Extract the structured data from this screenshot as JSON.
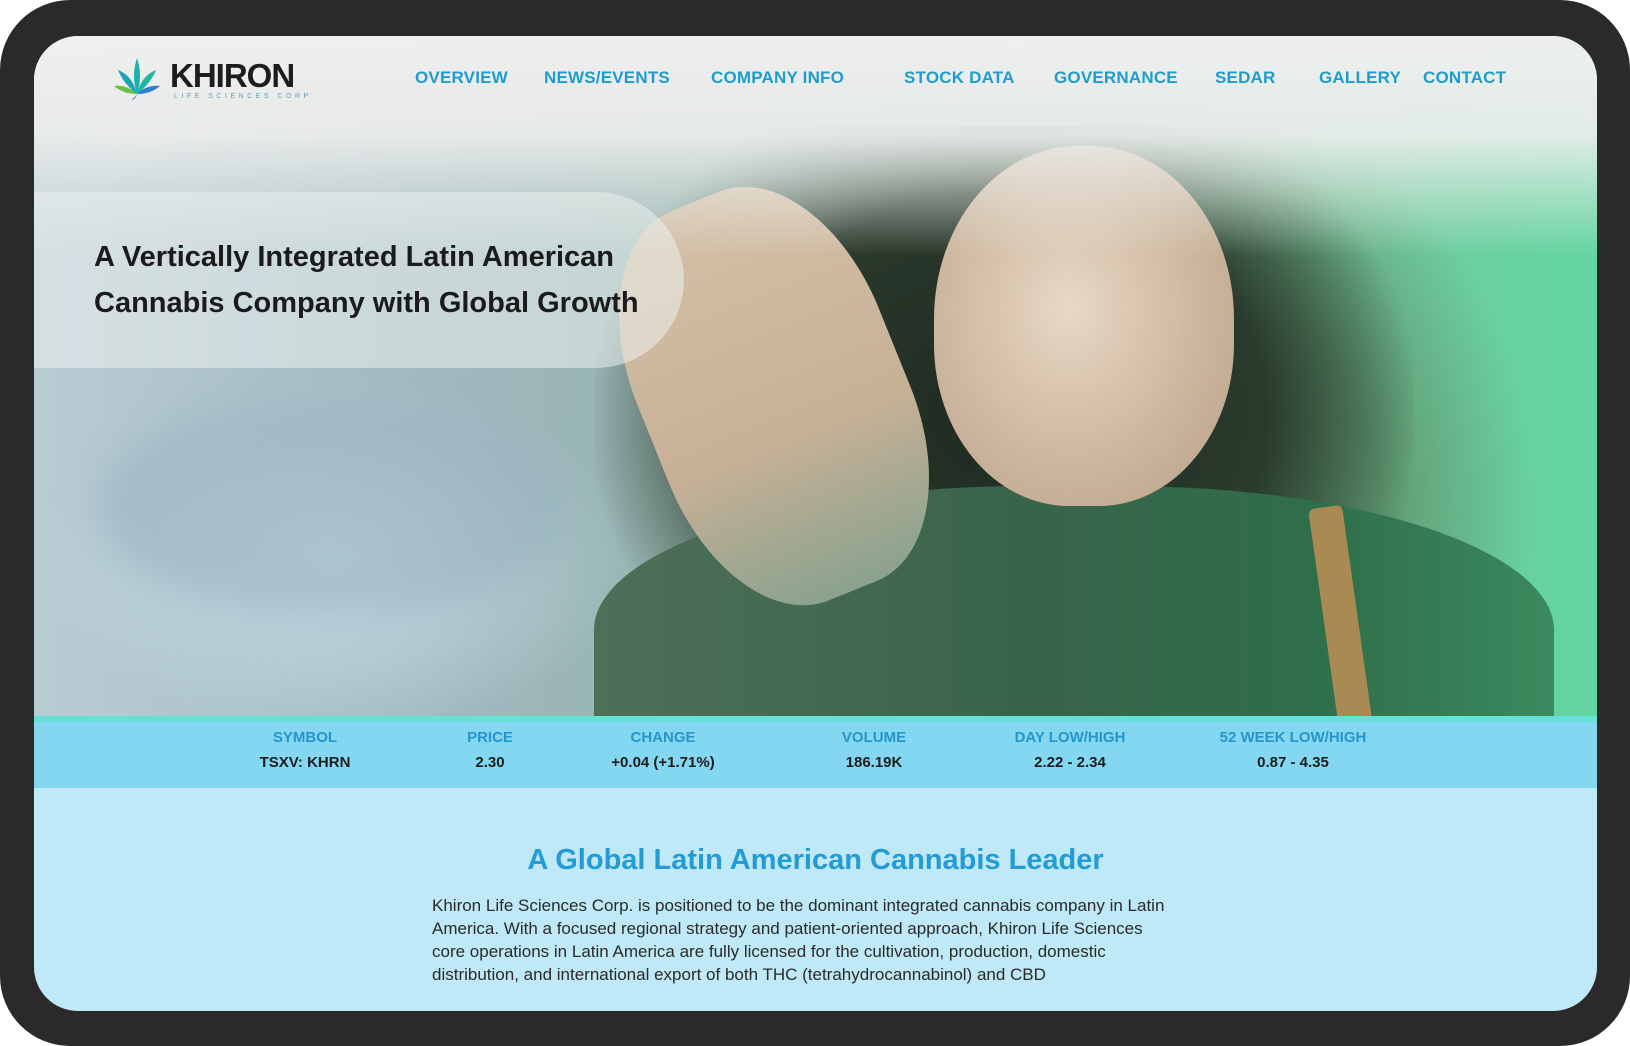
{
  "brand": {
    "name": "KHIRON",
    "tagline": "LIFE SCIENCES CORP",
    "colors": {
      "primary": "#1e9dcc",
      "leaf_teal": "#1bb3a8",
      "leaf_green": "#6cc04a",
      "leaf_blue": "#2f7fd0"
    }
  },
  "nav": {
    "items": [
      {
        "label": "OVERVIEW"
      },
      {
        "label": "NEWS/EVENTS"
      },
      {
        "label": "COMPANY INFO"
      },
      {
        "label": "STOCK DATA"
      },
      {
        "label": "GOVERNANCE"
      },
      {
        "label": "SEDAR"
      },
      {
        "label": "GALLERY"
      },
      {
        "label": "CONTACT"
      }
    ]
  },
  "hero": {
    "line1": "A Vertically Integrated Latin American",
    "line2": "Cannabis Company with Global Growth"
  },
  "stock": {
    "columns": [
      {
        "label": "SYMBOL",
        "value": "TSXV: KHRN"
      },
      {
        "label": "PRICE",
        "value": "2.30"
      },
      {
        "label": "CHANGE",
        "value": "+0.04 (+1.71%)"
      },
      {
        "label": "VOLUME",
        "value": "186.19K"
      },
      {
        "label": "DAY LOW/HIGH",
        "value": "2.22 - 2.34"
      },
      {
        "label": "52 WEEK LOW/HIGH",
        "value": "0.87 - 4.35"
      }
    ]
  },
  "about": {
    "title": "A Global Latin American Cannabis Leader",
    "body": "Khiron Life Sciences Corp. is positioned to be the dominant integrated cannabis company in Latin America. With a focused regional strategy and patient-oriented approach, Khiron Life Sciences core operations in Latin America are fully licensed for the cultivation, production, domestic distribution, and international export of both THC (tetrahydrocannabinol) and CBD"
  }
}
